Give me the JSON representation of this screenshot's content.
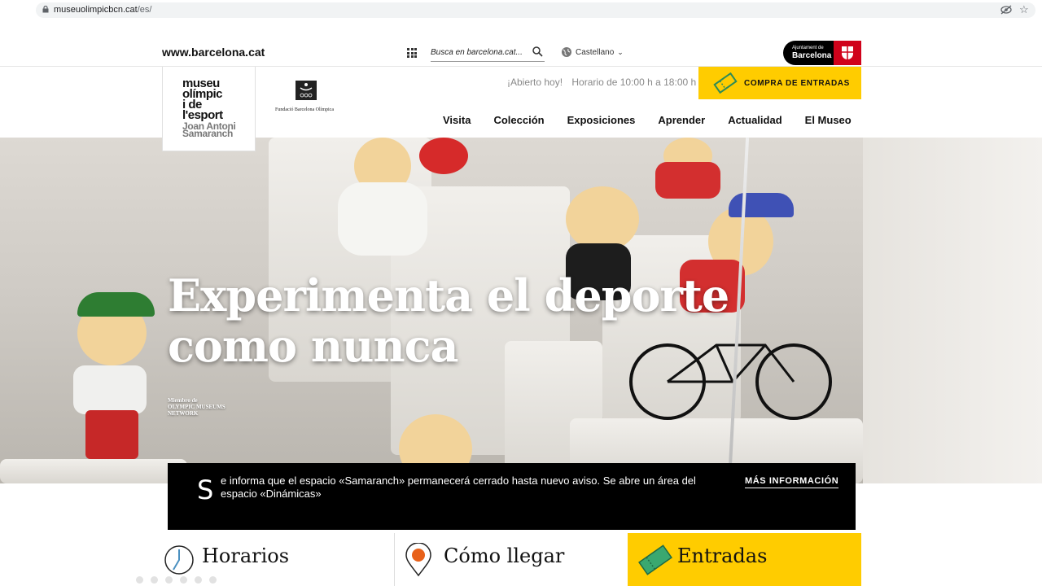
{
  "browser": {
    "url_host": "museuolimpicbcn.cat",
    "url_path": "/es/"
  },
  "topbar": {
    "site_link": "www.barcelona.cat",
    "search_placeholder": "Busca en barcelona.cat...",
    "language": "Castellano",
    "ajuntament_small": "Ajuntament de",
    "ajuntament_big": "Barcelona"
  },
  "header": {
    "logo_lines": [
      "museu",
      "olímpic",
      "i de",
      "l'esport"
    ],
    "logo_sub": [
      "Joan Antoni",
      "Samaranch"
    ],
    "foundation": "Fundació Barcelona Olímpica",
    "open_status": "¡Abierto hoy!",
    "hours": "Horario de 10:00 h a 18:00 h",
    "buy_tickets": "COMPRA DE ENTRADAS",
    "nav": [
      "Visita",
      "Colección",
      "Exposiciones",
      "Aprender",
      "Actualidad",
      "El Museo"
    ]
  },
  "hero": {
    "title_line1": "Experimenta el deporte",
    "title_line2": "como nunca",
    "network_line1": "Miembro de",
    "network_line2": "OLYMPIC MUSEUMS",
    "network_line3": "NETWORK"
  },
  "notice": {
    "dropcap": "S",
    "message": "e informa que el espacio «Samaranch» permanecerá cerrado hasta nuevo aviso. Se abre un área del espacio «Dinámicas»",
    "more": "MÁS INFORMACIÓN"
  },
  "cards": [
    {
      "label": "Horarios",
      "icon": "clock-icon"
    },
    {
      "label": "Cómo llegar",
      "icon": "location-pin-icon"
    },
    {
      "label": "Entradas",
      "icon": "ticket-icon"
    }
  ],
  "colors": {
    "accent": "#ffcc00",
    "notice_bg": "#000000",
    "ajuntament_red": "#d0021b"
  }
}
